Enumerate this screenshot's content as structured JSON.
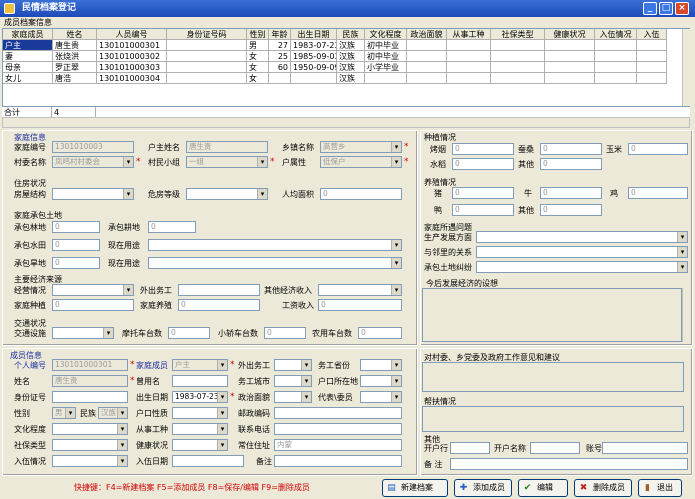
{
  "window": {
    "title": "民情档案登记",
    "min": "_",
    "max": "□",
    "close": "×"
  },
  "grid_section": "成员档案信息",
  "grid": {
    "columns": [
      "家庭成员",
      "姓名",
      "人员编号",
      "身份证号码",
      "性别",
      "年龄",
      "出生日期",
      "民族",
      "文化程度",
      "政治面貌",
      "从事工种",
      "社保类型",
      "健康状况",
      "入伍情况",
      "入伍"
    ],
    "rows": [
      [
        "户主",
        "唐生贵",
        "130101000301",
        "",
        "男",
        "27",
        "1983-07-23",
        "汉族",
        "初中毕业",
        "",
        "",
        "",
        "",
        "",
        ""
      ],
      [
        "妻",
        "张烧洪",
        "130101000302",
        "",
        "女",
        "25",
        "1985-09-03",
        "汉族",
        "初中毕业",
        "",
        "",
        "",
        "",
        "",
        ""
      ],
      [
        "母亲",
        "罗正翠",
        "130101000303",
        "",
        "女",
        "60",
        "1950-09-09",
        "汉族",
        "小学毕业",
        "",
        "",
        "",
        "",
        "",
        ""
      ],
      [
        "女儿",
        "唐浩",
        "130101000304",
        "",
        "女",
        "",
        "",
        "汉族",
        "",
        "",
        "",
        "",
        "",
        "",
        ""
      ]
    ],
    "total_label": "合计",
    "total_value": "4"
  },
  "family": {
    "title": "家庭信息",
    "no_label": "家庭编号",
    "no_value": "1301010003",
    "head_label": "户主姓名",
    "head_value": "唐生贵",
    "town_label": "乡镇名称",
    "town_value": "高营乡",
    "village_label": "村委名称",
    "village_value": "凤鸣村村委会",
    "group_label": "村民小组",
    "group_value": "一组",
    "type_label": "户属性",
    "type_value": "低保户"
  },
  "housing": {
    "title": "住房状况",
    "struct_label": "房屋结构",
    "danger_label": "危房等级",
    "area_label": "人均面积",
    "area_value": "0"
  },
  "land": {
    "title": "家庭承包土地",
    "r1a": "承包林地",
    "r1b": "承包耕地",
    "r2a": "承包水田",
    "r2b": "现在用途",
    "r3a": "承包旱地",
    "r3b": "现在用途",
    "zero": "0"
  },
  "econ": {
    "title": "主要经济来源",
    "type_label": "经营情况",
    "work_label": "外出务工",
    "other_label": "其他经济收入",
    "plant_label": "家庭种植",
    "breed_label": "家庭养殖",
    "wage_label": "工资收入",
    "zero": "0"
  },
  "traffic": {
    "title": "交通状况",
    "tool_label": "交通设施",
    "moto_label": "摩托车台数",
    "car_label": "小轿车台数",
    "truck_label": "农用车台数",
    "zero": "0"
  },
  "plant": {
    "title": "种植情况",
    "tobacco": "烤烟",
    "silk": "蚕桑",
    "corn": "玉米",
    "rice": "水稻",
    "other": "其他",
    "zero": "0"
  },
  "breed": {
    "title": "养殖情况",
    "pig": "猪",
    "cow": "牛",
    "chicken": "鸡",
    "sheep": "鸭",
    "other": "其他",
    "zero": "0"
  },
  "problems": {
    "title": "家庭所遇问题",
    "a": "生产发展方面",
    "b": "与邻里的关系",
    "c": "承包土地纠纷"
  },
  "future": {
    "title": "今后发展经济的设想"
  },
  "member": {
    "title": "成员信息",
    "no_label": "个人编号",
    "no_value": "130101000301",
    "role_label": "家庭成员",
    "role_value": "户主",
    "out_label": "外出务工",
    "prov_label": "务工省份",
    "name_label": "姓名",
    "name_value": "唐生贵",
    "alias_label": "曾用名",
    "city_label": "务工城市",
    "hukou_label": "户口所在地",
    "id_label": "身份证号",
    "birth_label": "出生日期",
    "birth_value": "1983-07-23",
    "party_label": "政治面貌",
    "rep_label": "代表\\委员",
    "sex_label": "性别",
    "sex_value": "男",
    "nation_label": "民族",
    "nation_value": "汉族",
    "hk_label": "户口性质",
    "zip_label": "邮政编码",
    "edu_label": "文化程度",
    "job_label": "从事工种",
    "tel_label": "联系电话",
    "social_label": "社保类型",
    "health_label": "健康状况",
    "addr_label": "常住住址",
    "addr_value": "内蒙",
    "army_label": "入伍情况",
    "armydate_label": "入伍日期",
    "note_label": "备注"
  },
  "opinion": {
    "title": "对村委、乡党委及政府工作意见和建议"
  },
  "help": {
    "title": "帮扶情况"
  },
  "other": {
    "title": "其他",
    "bank_label": "开户行",
    "acct_name_label": "开户名称",
    "acct_label": "账号",
    "memo_label": "备 注"
  },
  "hotkeys": "快捷键：F4=新建档案   F5=添加成员   F8=保存/编辑   F9=删除成员",
  "buttons": {
    "new": "新建档案",
    "add": "添加成员",
    "edit": "编辑",
    "del": "删除成员",
    "exit": "退出"
  }
}
